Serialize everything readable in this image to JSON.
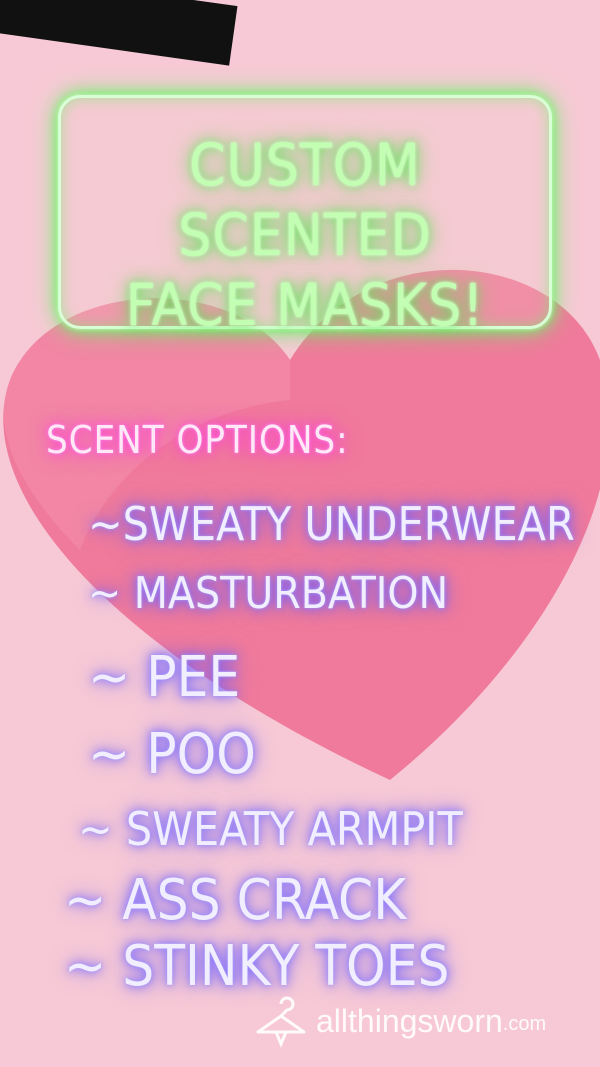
{
  "colors": {
    "background": "#f7c9d6",
    "heart": "#ef7396",
    "neon_green": "#6ff26a",
    "neon_pink": "#ff3fd8",
    "neon_violet": "#6b5cff"
  },
  "title_sign": {
    "text": "CUSTOM SCENTED\nFACE MASKS!"
  },
  "scent_options": {
    "heading": "SCENT OPTIONS:",
    "items": [
      "~SWEATY UNDERWEAR",
      "~ MASTURBATION",
      "~ PEE",
      "~ POO",
      "~ SWEATY ARMPIT",
      "~ ASS CRACK",
      "~ STINKY TOES"
    ]
  },
  "watermark": {
    "icon": "hanger-icon",
    "name": "allthingsworn",
    "tld": ".com"
  }
}
